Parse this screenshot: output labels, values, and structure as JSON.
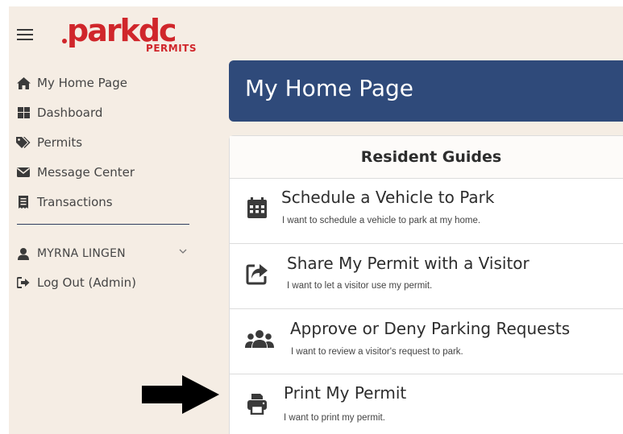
{
  "brand": {
    "logo_text": "parkdc",
    "logo_subtext": "PERMITS",
    "brand_color": "#d0262b"
  },
  "sidebar": {
    "items": [
      {
        "label": "My Home Page",
        "icon": "home-icon"
      },
      {
        "label": "Dashboard",
        "icon": "dashboard-icon"
      },
      {
        "label": "Permits",
        "icon": "tags-icon"
      },
      {
        "label": "Message Center",
        "icon": "envelope-icon"
      },
      {
        "label": "Transactions",
        "icon": "receipt-icon"
      }
    ],
    "user": {
      "name": "MYRNA LINGEN",
      "icon": "user-icon"
    },
    "logout": {
      "label": "Log Out (Admin)",
      "icon": "sign-out-icon"
    }
  },
  "main": {
    "title": "My Home Page",
    "section_title": "Resident Guides",
    "guides": [
      {
        "title": "Schedule a Vehicle to Park",
        "description": "I want to schedule a vehicle to park at my home.",
        "icon": "calendar-icon"
      },
      {
        "title": "Share My Permit with a Visitor",
        "description": "I want to let a visitor use my permit.",
        "icon": "share-icon"
      },
      {
        "title": "Approve or Deny Parking Requests",
        "description": "I want to review a visitor's request to park.",
        "icon": "users-icon"
      },
      {
        "title": "Print My Permit",
        "description": "I want to print my permit.",
        "icon": "print-icon"
      }
    ]
  },
  "colors": {
    "sidebar_bg": "#f5ede4",
    "title_bar": "#2f4a7a",
    "icon_color": "#3a3a3a"
  }
}
